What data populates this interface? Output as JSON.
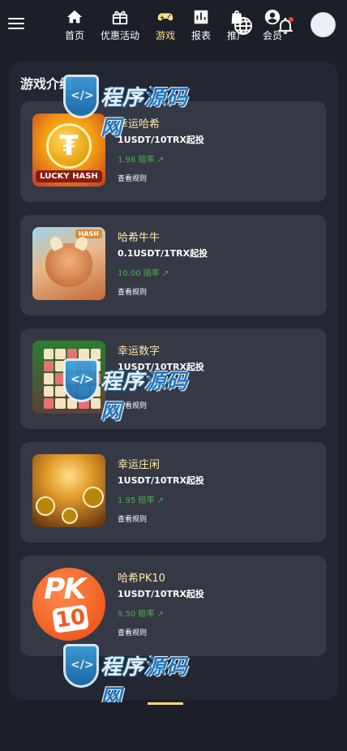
{
  "header": {
    "menu_icon": "hamburger-menu-icon",
    "language_icon": "globe-icon",
    "notification_icon": "bell-icon",
    "notification_dot_color": "#ff3b30"
  },
  "section": {
    "title": "游戏介绍"
  },
  "games": [
    {
      "name": "幸运哈希",
      "min_bet": "1USDT/10TRX起投",
      "odds": "1.98 赔率 ↗",
      "rules_link": "查看规则",
      "thumb_label": "LUCKY HASH",
      "thumb_glyph": "₮"
    },
    {
      "name": "哈希牛牛",
      "min_bet": "0.1USDT/1TRX起投",
      "odds": "10.00 赔率 ↗",
      "rules_link": "查看规则",
      "thumb_label": "HASH"
    },
    {
      "name": "幸运数字",
      "min_bet": "1USDT/10TRX起投",
      "odds": "",
      "rules_link": "查看规则"
    },
    {
      "name": "幸运庄闲",
      "min_bet": "1USDT/10TRX起投",
      "odds": "1.95 赔率 ↗",
      "rules_link": "查看规则"
    },
    {
      "name": "哈希PK10",
      "min_bet": "1USDT/10TRX起投",
      "odds": "9.50 赔率 ↗",
      "rules_link": "查看规则",
      "thumb_label": "PK",
      "thumb_number": "10"
    }
  ],
  "watermark": {
    "text_main": "程序",
    "text_accent": "源码网",
    "shield_glyph": "</>"
  },
  "bottom_nav": [
    {
      "label": "首页",
      "icon": "home-icon"
    },
    {
      "label": "优惠活动",
      "icon": "gift-icon"
    },
    {
      "label": "游戏",
      "icon": "gamepad-icon",
      "active": true
    },
    {
      "label": "报表",
      "icon": "bar-chart-icon"
    },
    {
      "label": "推广",
      "icon": "shopping-bag-icon"
    },
    {
      "label": "会员",
      "icon": "user-circle-icon"
    }
  ],
  "colors": {
    "background": "#1c1f27",
    "panel": "#232732",
    "card": "#343945",
    "game_name": "#ffe9a8",
    "odds": "#4caf50",
    "active_nav": "#ffd780"
  }
}
